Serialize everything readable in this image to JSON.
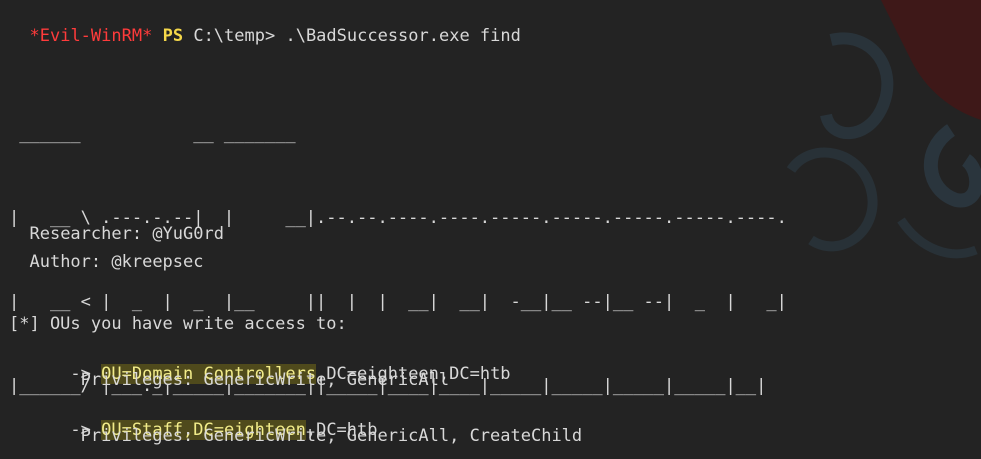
{
  "terminal": {
    "prompt_star_open": "*",
    "prompt_host": "Evil-WinRM",
    "prompt_star_close": "*",
    "prompt_ps": "PS",
    "prompt_path": "C:\\temp>",
    "command": ".\\BadSuccessor.exe find",
    "banner_lines": [
      " ______           __ _______",
      "|   __ \\ .---.-.--|  |     __|.--.--.----.----.-----.-----.-----.-----.----.",
      "|   __ < |  _  |  _  |__     ||  |  |  __|  __|  -__|__ --|__ --|  _  |   _|",
      "|______/ |___._|_____|_______||_____|____|____|_____|_____|_____|_____|__|"
    ],
    "researcher_label": "Researcher: ",
    "researcher_value": "@YuG0rd",
    "author_label": "Author: ",
    "author_value": "@kreepsec",
    "ou_header": "[*] OUs you have write access to:",
    "entries": [
      {
        "arrow": "    -> ",
        "dn_highlight": "OU=Domain Controllers",
        "dn_rest": ",DC=eighteen,DC=htb",
        "privileges": "       Privileges: GenericWrite, GenericAll"
      },
      {
        "arrow": "    -> ",
        "dn_highlight": "OU=Staff,DC=eighteen",
        "dn_rest": ",DC=htb",
        "privileges": "       Privileges: GenericWrite, GenericAll, CreateChild"
      }
    ]
  },
  "colors": {
    "background": "#232323",
    "text": "#d8d8d8",
    "prompt_host": "#ff3b3b",
    "prompt_ps": "#f5d84a",
    "highlight_bg": "#4f4a1c",
    "highlight_fg": "#f2ec8a"
  },
  "icons": {
    "watermark": "tribal-swirl-watermark"
  }
}
